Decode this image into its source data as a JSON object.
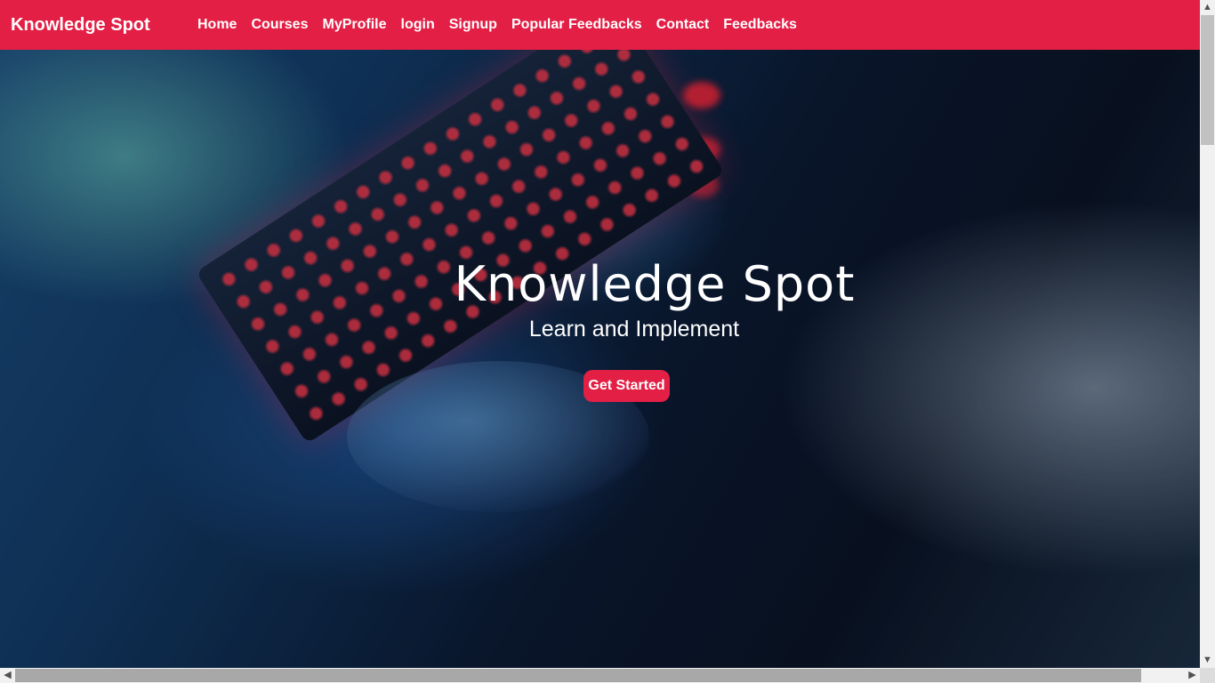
{
  "navbar": {
    "brand": "Knowledge Spot",
    "links": [
      "Home",
      "Courses",
      "MyProfile",
      "login",
      "Signup",
      "Popular Feedbacks",
      "Contact",
      "Feedbacks"
    ],
    "background_color": "#e31f45"
  },
  "hero": {
    "title": "Knowledge Spot",
    "subtitle": "Learn and Implement",
    "cta_label": "Get Started",
    "cta_color": "#e31f45"
  },
  "scrollbars": {
    "up_icon": "chevron-up-icon",
    "down_icon": "chevron-down-icon",
    "left_icon": "chevron-left-icon",
    "right_icon": "chevron-right-icon"
  }
}
